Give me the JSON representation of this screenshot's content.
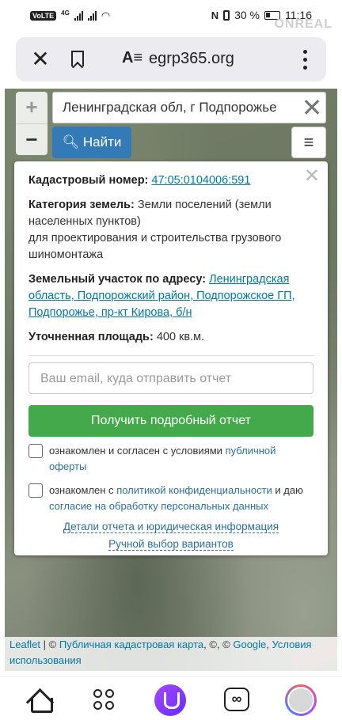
{
  "status_bar": {
    "volte": "VoLTE",
    "network_gen": "4G",
    "battery_percent": "30 %",
    "time": "11:16",
    "watermark": "ONREAL"
  },
  "browser": {
    "url": "egrp365.org"
  },
  "map": {
    "zoom_in": "+",
    "zoom_out": "−",
    "search_value": "Ленинградская обл, г Подпорожье",
    "find_label": "Найти",
    "menu_symbol": "≡",
    "attribution": {
      "leaflet": "Leaflet",
      "sep1": " | © ",
      "map_link": "Публичная кадастровая карта",
      "sep2": ", ©, © ",
      "google_link": "Google",
      "sep3": ", ",
      "terms_link": "Условия использования"
    }
  },
  "panel": {
    "close_symbol": "✕",
    "cadastral_label": "Кадастровый номер:",
    "cadastral_number": "47:05:0104006:591",
    "category_label": "Категория земель:",
    "category_value": "Земли поселений (земли населенных пунктов)",
    "purpose_value": "для проектирования и строительства грузового шиномонтажа",
    "address_label": "Земельный участок по адресу:",
    "address_value": "Ленинградская область, Подпорожский район, Подпорожское ГП, Подпорожье, пр-кт Кирова, б/н",
    "area_label": "Уточненная площадь:",
    "area_value": "400 кв.м.",
    "email_placeholder": "Ваш email, куда отправить отчет",
    "report_button": "Получить подробный отчет",
    "consent1_text": "ознакомлен и согласен с условиями ",
    "consent1_link": "публичной оферты",
    "consent2_text": "ознакомлен с ",
    "consent2_link1": "политикой конфиденциальности",
    "consent2_mid": " и даю ",
    "consent2_link2": "согласие на обработку персональных данных",
    "details_link": "Детали отчета и юридическая информация",
    "manual_link": "Ручной выбор вариантов"
  },
  "bottom_nav": {
    "tabs_icon": "∞"
  }
}
